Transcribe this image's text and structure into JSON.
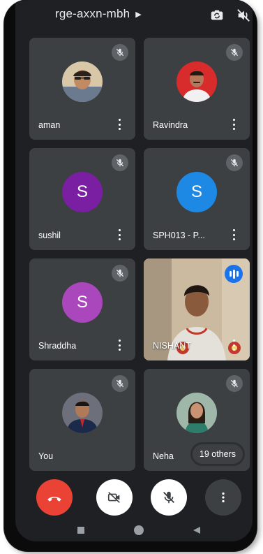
{
  "header": {
    "meeting_code": "rge-axxn-mbh",
    "icons": [
      "chevron-right-icon",
      "switch-camera-icon",
      "audio-output-icon"
    ]
  },
  "participants": [
    {
      "name": "aman",
      "avatar": "photo",
      "muted": true
    },
    {
      "name": "Ravindra",
      "avatar": "photo",
      "muted": true
    },
    {
      "name": "sushil",
      "avatar_letter": "S",
      "avatar_color": "#7b1fa2",
      "muted": true
    },
    {
      "name": "SPH013 - P...",
      "avatar_letter": "S",
      "avatar_color": "#1e88e5",
      "muted": true
    },
    {
      "name": "Shraddha",
      "avatar_letter": "S",
      "avatar_color": "#ab47bc",
      "muted": true
    },
    {
      "name": "NISHANT",
      "avatar": "video",
      "speaking": true
    },
    {
      "name": "You",
      "avatar": "photo",
      "muted": true
    },
    {
      "name": "Neha",
      "avatar": "photo",
      "muted": true,
      "others_badge": "19 others"
    }
  ],
  "controls": {
    "end_call_color": "#ea4335",
    "buttons": [
      "end-call-icon",
      "camera-off-icon",
      "mic-off-icon",
      "more-options-icon"
    ]
  },
  "colors": {
    "background": "#1f2023",
    "tile": "#3c4043",
    "speaking": "#1a73e8"
  }
}
